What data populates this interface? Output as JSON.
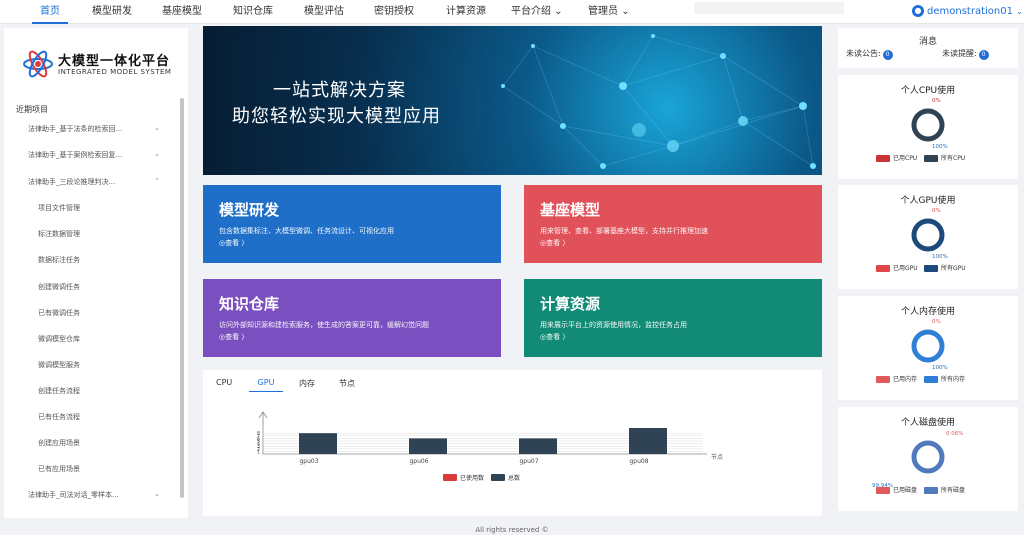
{
  "nav": {
    "items": [
      "首页",
      "模型研发",
      "基座模型",
      "知识仓库",
      "模型评估",
      "密钥授权",
      "计算资源",
      "平台介绍",
      "管理员"
    ],
    "user": "demonstration01"
  },
  "sidebar": {
    "logo_title": "大模型一体化平台",
    "logo_subtitle": "INTEGRATED MODEL SYSTEM",
    "section": "近期项目",
    "projects": [
      "法律助手_基于法条的检索回...",
      "法律助手_基于案例检索回复...",
      "法律助手_三段论推理判决..."
    ],
    "subitems": [
      "项目文件管理",
      "标注数据管理",
      "数据标注任务",
      "创建微调任务",
      "已有微调任务",
      "微调模型仓库",
      "微调模型服务",
      "创建任务流程",
      "已有任务流程",
      "创建应用场景",
      "已有应用场景"
    ],
    "last_project": "法律助手_司法对话_零样本..."
  },
  "banner": {
    "line1": "一站式解决方案",
    "line2": "助您轻松实现大模型应用"
  },
  "cards": [
    {
      "title": "模型研发",
      "desc": "包含数据集标注、大模型微调、任务流设计、可视化应用",
      "link": "◎查看 〉",
      "color": "#1f6fc9"
    },
    {
      "title": "基座模型",
      "desc": "用来管理、查看、部署基座大模型，支持并行推理加速",
      "link": "◎查看 〉",
      "color": "#e05159"
    },
    {
      "title": "知识仓库",
      "desc": "访问外部知识源和建检索服务，使生成的答案更可靠，缓解幻觉问题",
      "link": "◎查看 〉",
      "color": "#7a4fbf"
    },
    {
      "title": "计算资源",
      "desc": "用来展示平台上的资源使用情况，监控任务占用",
      "link": "◎查看 〉",
      "color": "#118a76"
    }
  ],
  "tabs": [
    "CPU",
    "GPU",
    "内存",
    "节点"
  ],
  "chart_data": {
    "type": "bar",
    "categories": [
      "gpu03",
      "gpu06",
      "gpu07",
      "gpu08"
    ],
    "series": [
      {
        "name": "已使用数",
        "values": [
          0,
          0,
          0,
          0
        ],
        "color": "#d93a3a"
      },
      {
        "name": "总数",
        "values": [
          8,
          6,
          6,
          10
        ],
        "color": "#2f4354"
      }
    ],
    "xlabel": "节点",
    "yticks": [
      "1",
      "2",
      "3",
      "4",
      "5",
      "6",
      "7",
      "8"
    ],
    "ylim": [
      0,
      10
    ],
    "legend": "bottom"
  },
  "messages": {
    "title": "消息",
    "unread_notice_label": "未读公告:",
    "unread_notice": "0",
    "unread_remind_label": "未读提醒:",
    "unread_remind": "0"
  },
  "usage": [
    {
      "title": "个人CPU使用",
      "used_pct": "0%",
      "total_pct": "100%",
      "used_fraction": 0,
      "legend_used": "已用CPU",
      "legend_total": "所有CPU",
      "used_color": "#c33",
      "ring_color": "#2f4354"
    },
    {
      "title": "个人GPU使用",
      "used_pct": "0%",
      "total_pct": "100%",
      "used_fraction": 0,
      "legend_used": "已用GPU",
      "legend_total": "所有GPU",
      "used_color": "#e04848",
      "ring_color": "#1c4a7a"
    },
    {
      "title": "个人内存使用",
      "used_pct": "0%",
      "total_pct": "100%",
      "used_fraction": 0,
      "legend_used": "已用内存",
      "legend_total": "所有内存",
      "used_color": "#e05a5a",
      "ring_color": "#2f7fd6"
    },
    {
      "title": "个人磁盘使用",
      "used_pct": "0.06%",
      "total_pct": "99.94%",
      "used_fraction": 0.0006,
      "legend_used": "已用磁盘",
      "legend_total": "所有磁盘",
      "used_color": "#e05a5a",
      "ring_color": "#4f7bbd"
    }
  ],
  "footer": "All rights reserved ©"
}
